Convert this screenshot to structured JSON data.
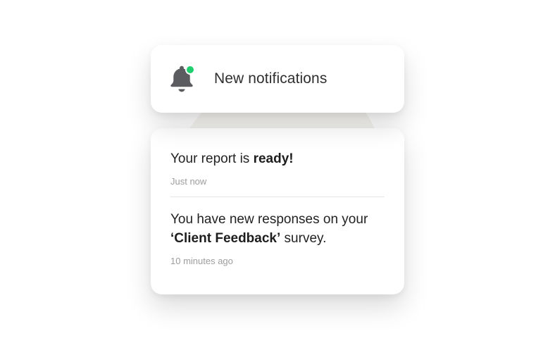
{
  "header": {
    "title": "New notifications",
    "icon": "bell-icon",
    "badge_color": "#1FCE6D"
  },
  "notifications": {
    "0": {
      "text_pre": "Your report is ",
      "text_bold": "ready!",
      "text_post": "",
      "time": "Just now"
    },
    "1": {
      "text_pre": "You have new responses on your ",
      "text_bold": "‘Client Feedback’",
      "text_post": " survey.",
      "time": "10 minutes ago"
    }
  },
  "colors": {
    "blob": "#F6F4F0",
    "bell": "#5A5C60",
    "accent": "#1FCE6D",
    "text": "#222222",
    "muted": "#9d9d9d"
  }
}
